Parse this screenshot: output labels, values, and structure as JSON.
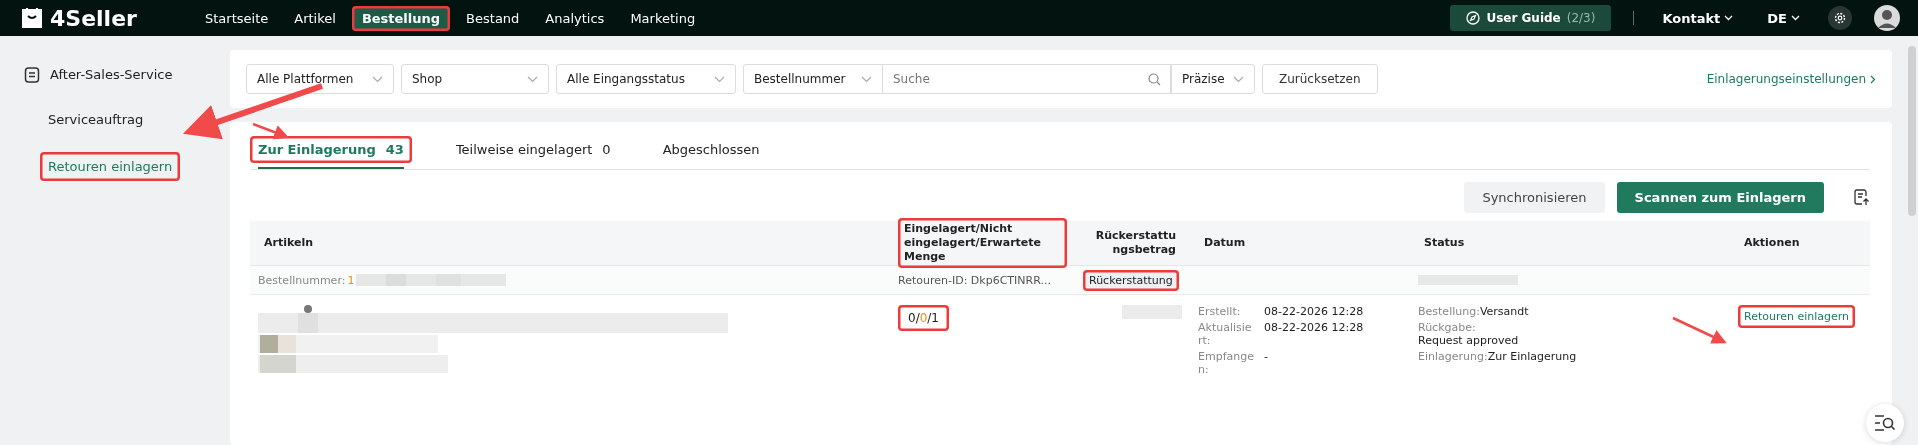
{
  "logo": "4Seller",
  "nav": [
    {
      "label": "Startseite",
      "selected": false,
      "highlighted": false
    },
    {
      "label": "Artikel",
      "selected": false,
      "highlighted": false
    },
    {
      "label": "Bestellung",
      "selected": true,
      "highlighted": true
    },
    {
      "label": "Bestand",
      "selected": false,
      "highlighted": false
    },
    {
      "label": "Analytics",
      "selected": false,
      "highlighted": false
    },
    {
      "label": "Marketing",
      "selected": false,
      "highlighted": false
    }
  ],
  "user_guide": {
    "label": "User Guide",
    "progress": "(2/3)"
  },
  "contact": "Kontakt",
  "language": "DE",
  "sidebar": {
    "group": "After-Sales-Service",
    "items": [
      {
        "label": "Serviceauftrag",
        "selected": false,
        "highlighted": false
      },
      {
        "label": "Retouren einlagern",
        "selected": true,
        "highlighted": true
      }
    ]
  },
  "filters": {
    "selects": [
      "Alle Plattformen",
      "Shop",
      "Alle Eingangsstatus",
      "Bestellnummer"
    ],
    "search_placeholder": "Suche",
    "match": "Präzise",
    "reset": "Zurücksetzen",
    "settings_link": "Einlagerungseinstellungen"
  },
  "tabs": [
    {
      "label": "Zur Einlagerung",
      "count": "43",
      "selected": true,
      "highlighted": true
    },
    {
      "label": "Teilweise eingelagert",
      "count": "0",
      "selected": false,
      "highlighted": false
    },
    {
      "label": "Abgeschlossen",
      "selected": false,
      "highlighted": false
    }
  ],
  "actions": {
    "sync": "Synchronisieren",
    "scan": "Scannen zum Einlagern"
  },
  "table": {
    "columns": [
      {
        "label": "Artikeln",
        "highlighted": false
      },
      {
        "label": "Eingelagert/Nicht eingelagert/Erwartete Menge",
        "highlighted": true
      },
      {
        "label": "Rückerstattungsbetrag",
        "highlighted": false
      },
      {
        "label": "Datum",
        "highlighted": false
      },
      {
        "label": "Status",
        "highlighted": false
      },
      {
        "label": "Aktionen",
        "highlighted": false
      }
    ],
    "order": {
      "number_label": "Bestellnummer:",
      "number": "1",
      "return_id": "Retouren-ID: Dkp6CTINRR...",
      "refund_tag": "Rückerstattung",
      "refund_highlighted": true
    },
    "row": {
      "qty_parts": [
        {
          "text": "0/",
          "color": "#222222"
        },
        {
          "text": "0",
          "color": "#f08a1c"
        },
        {
          "text": "/1",
          "color": "#222222"
        }
      ],
      "qty_highlighted": true,
      "dates": [
        {
          "label": "Erstellt:",
          "value": "08-22-2026 12:28"
        },
        {
          "label": "Aktualisiert:",
          "value": "08-22-2026 12:28"
        },
        {
          "label": "Empfangen:",
          "value": "-"
        }
      ],
      "status": [
        {
          "label": "Bestellung:",
          "value": "Versandt"
        },
        {
          "label": "Rückgabe:",
          "value": "Request approved"
        },
        {
          "label": "Einlagerung:",
          "value": "Zur Einlagerung"
        }
      ],
      "action": "Retouren einlagern",
      "action_highlighted": true
    }
  }
}
